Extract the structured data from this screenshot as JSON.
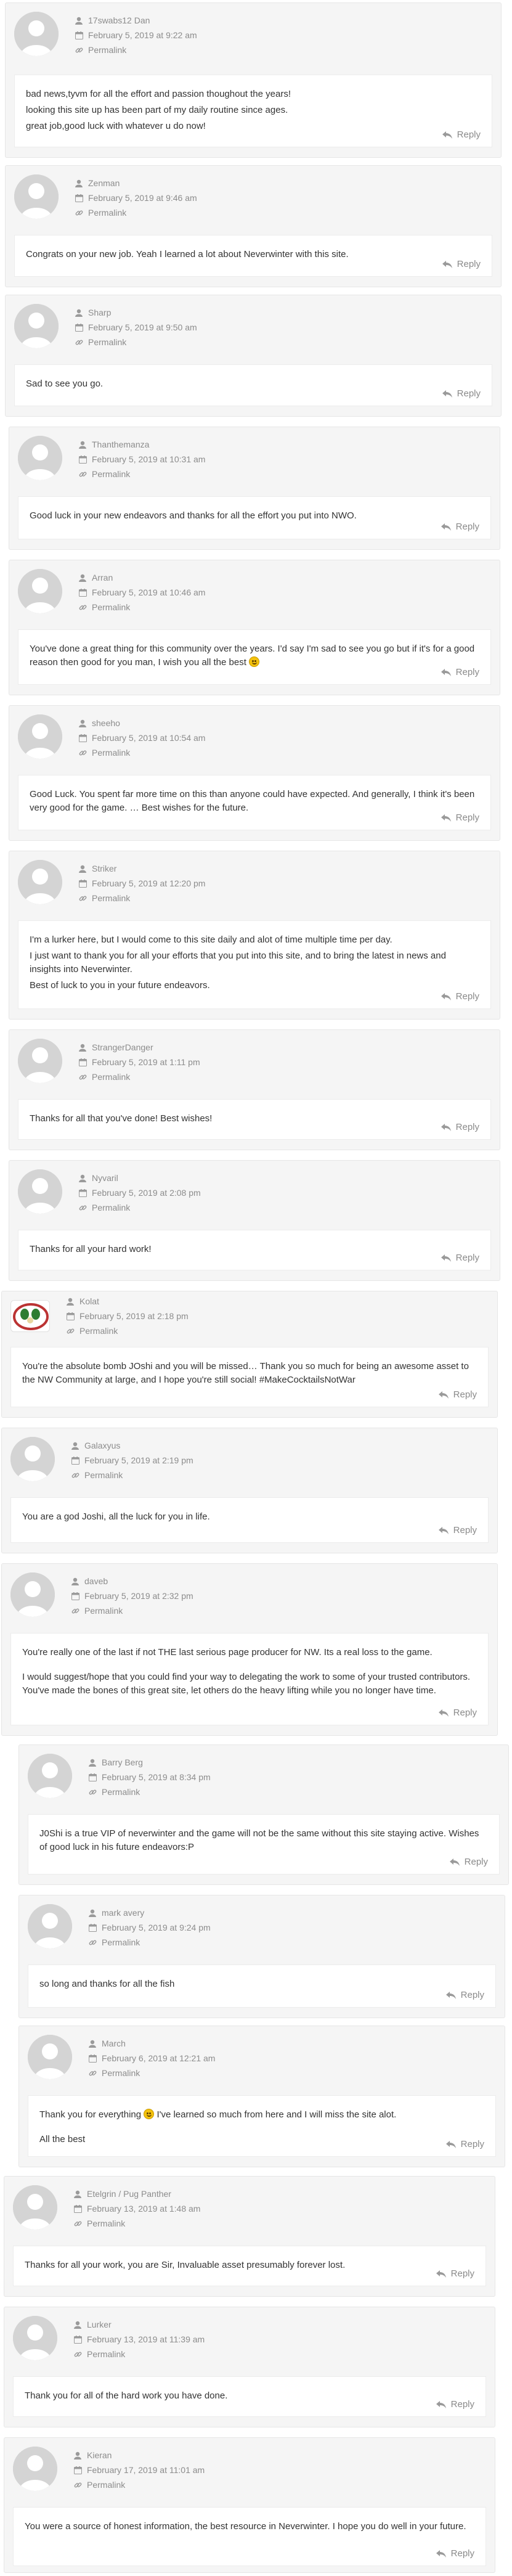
{
  "labels": {
    "permalink": "Permalink",
    "reply": "Reply"
  },
  "comments": [
    {
      "author": "17swabs12 Dan",
      "date": "February 5, 2019 at 9:22 am",
      "paragraphs": [
        "bad news,tyvm for all the effort and passion thoughout the years!",
        "looking this site up has been part of my daily routine since ages.",
        "great job,good luck with whatever u do now!"
      ]
    },
    {
      "author": "Zenman",
      "date": "February 5, 2019 at 9:46 am",
      "paragraphs": [
        "Congrats on your new job. Yeah I learned a lot about Neverwinter with this site."
      ]
    },
    {
      "author": "Sharp",
      "date": "February 5, 2019 at 9:50 am",
      "paragraphs": [
        "Sad to see you go."
      ]
    },
    {
      "author": "Thanthemanza",
      "date": "February 5, 2019 at 10:31 am",
      "paragraphs": [
        "Good luck in your new endeavors and thanks for all the effort you put into NWO."
      ]
    },
    {
      "author": "Arran",
      "date": "February 5, 2019 at 10:46 am",
      "paragraphs": [
        "You've done a great thing for this community over the years. I'd say I'm sad to see you go but if it's for a good reason then good for you man, I wish you all the best"
      ]
    },
    {
      "author": "sheeho",
      "date": "February 5, 2019 at 10:54 am",
      "paragraphs": [
        "Good Luck. You spent far more time on this than anyone could have expected. And generally, I think it's been very good for the game. … Best wishes for the future."
      ]
    },
    {
      "author": "Striker",
      "date": "February 5, 2019 at 12:20 pm",
      "paragraphs": [
        "I'm a lurker here, but I would come to this site daily and alot of time multiple time per day.",
        "I just want to thank you for all your efforts that you put into this site, and to bring the latest in news and insights into Neverwinter.",
        "Best of luck to you in your future endeavors."
      ]
    },
    {
      "author": "StrangerDanger",
      "date": "February 5, 2019 at 1:11 pm",
      "paragraphs": [
        "Thanks for all that you've done! Best wishes!"
      ]
    },
    {
      "author": "Nyvaril",
      "date": "February 5, 2019 at 2:08 pm",
      "paragraphs": [
        "Thanks for all your hard work!"
      ]
    },
    {
      "author": "Kolat",
      "date": "February 5, 2019 at 2:18 pm",
      "paragraphs": [
        "You're the absolute bomb JOshi and you will be missed… Thank you so much for being an awesome asset to the NW Community at large, and I hope you're still social! #MakeCocktailsNotWar"
      ]
    },
    {
      "author": "Galaxyus",
      "date": "February 5, 2019 at 2:19 pm",
      "paragraphs": [
        "You are a god Joshi, all the luck for you in life."
      ]
    },
    {
      "author": "daveb",
      "date": "February 5, 2019 at 2:32 pm",
      "paragraphs": [
        "You're really one of the last if not THE last serious page producer for NW. Its a real loss to the game.",
        "I would suggest/hope that you could find your way to delegating the work to some of your trusted contributors. You've made the bones of this great site, let others do the heavy lifting while you no longer have time."
      ]
    },
    {
      "author": "Barry Berg",
      "date": "February 5, 2019 at 8:34 pm",
      "paragraphs": [
        "J0Shi is a true VIP of neverwinter and the game will not be the same without this site staying active. Wishes of good luck in his future endeavors:P"
      ]
    },
    {
      "author": "mark avery",
      "date": "February 5, 2019 at 9:24 pm",
      "paragraphs": [
        "so long and thanks for all the fish"
      ]
    },
    {
      "author": "March",
      "date": "February 6, 2019 at 12:21 am",
      "paragraphs": [
        "Thank you for everything",
        "I've learned so much from here and I will miss the site alot.",
        "All the best"
      ]
    },
    {
      "author": "Etelgrin / Pug Panther",
      "date": "February 13, 2019 at 1:48 am",
      "paragraphs": [
        "Thanks for all your work, you are Sir, Invaluable asset presumably forever lost."
      ]
    },
    {
      "author": "Lurker",
      "date": "February 13, 2019 at 11:39 am",
      "paragraphs": [
        "Thank you for all of the hard work you have done."
      ]
    },
    {
      "author": "Kieran",
      "date": "February 17, 2019 at 11:01 am",
      "paragraphs": [
        "You were a source of honest information, the best resource in Neverwinter. I hope you do well in your future."
      ]
    }
  ]
}
